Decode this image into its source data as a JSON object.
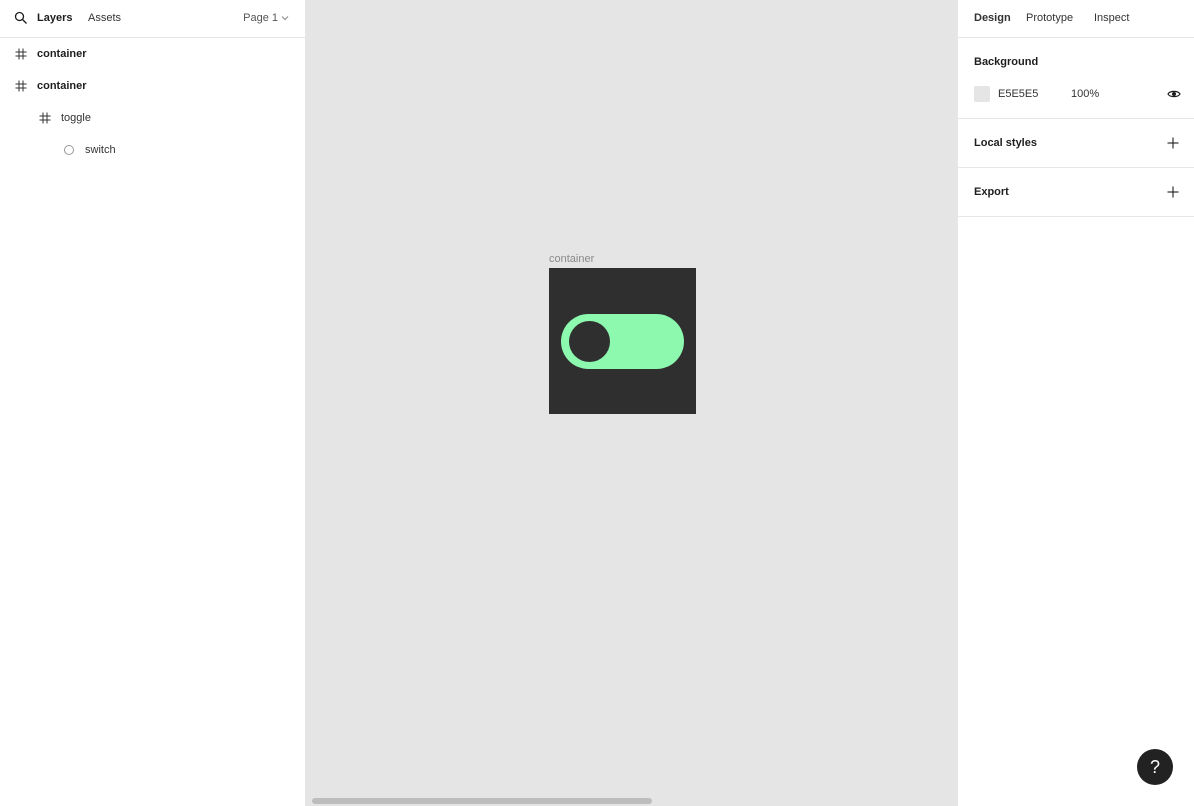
{
  "left_panel": {
    "tabs": {
      "layers": "Layers",
      "assets": "Assets"
    },
    "page_select": "Page 1",
    "layers": [
      {
        "name": "container",
        "icon": "frame-icon"
      },
      {
        "name": "container",
        "icon": "frame-icon"
      },
      {
        "name": "toggle",
        "icon": "frame-icon"
      },
      {
        "name": "switch",
        "icon": "ellipse-icon"
      }
    ]
  },
  "canvas": {
    "frame_label": "container",
    "frame_color": "#2f2f2f",
    "toggle_color": "#8cf9af",
    "knob_color": "#2f2f2f"
  },
  "right_panel": {
    "tabs": {
      "design": "Design",
      "prototype": "Prototype",
      "inspect": "Inspect"
    },
    "background": {
      "title": "Background",
      "hex": "E5E5E5",
      "opacity": "100%",
      "swatch_color": "#e5e5e5"
    },
    "local_styles": {
      "title": "Local styles"
    },
    "export": {
      "title": "Export"
    }
  },
  "help_label": "?"
}
